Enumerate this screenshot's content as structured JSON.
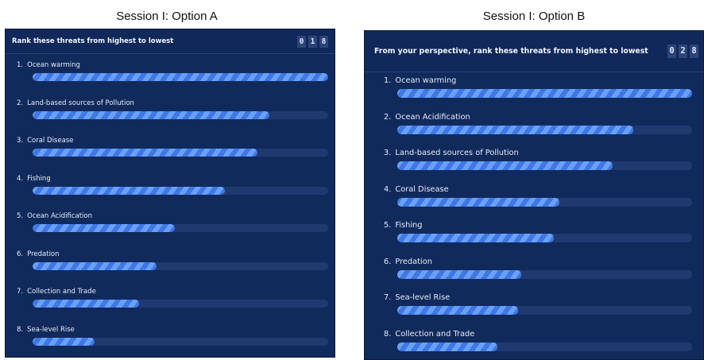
{
  "option_a": {
    "caption": "Session I: Option A",
    "question": "Rank these threats from highest to lowest",
    "counter": [
      "0",
      "1",
      "8"
    ],
    "items": [
      {
        "rank": "1.",
        "label": "Ocean warming",
        "fill": 1.0
      },
      {
        "rank": "2.",
        "label": "Land-based sources of Pollution",
        "fill": 0.8
      },
      {
        "rank": "3.",
        "label": "Coral Disease",
        "fill": 0.76
      },
      {
        "rank": "4.",
        "label": "Fishing",
        "fill": 0.65
      },
      {
        "rank": "5.",
        "label": "Ocean Acidification",
        "fill": 0.48
      },
      {
        "rank": "6.",
        "label": "Predation",
        "fill": 0.42
      },
      {
        "rank": "7.",
        "label": "Collection and Trade",
        "fill": 0.36
      },
      {
        "rank": "8.",
        "label": "Sea-level Rise",
        "fill": 0.21
      }
    ]
  },
  "option_b": {
    "caption": "Session I: Option B",
    "question": "From your perspective, rank these threats from highest to lowest",
    "counter": [
      "0",
      "2",
      "8"
    ],
    "items": [
      {
        "rank": "1.",
        "label": "Ocean warming",
        "fill": 1.0
      },
      {
        "rank": "2.",
        "label": "Ocean Acidification",
        "fill": 0.8
      },
      {
        "rank": "3.",
        "label": "Land-based sources of Pollution",
        "fill": 0.73
      },
      {
        "rank": "4.",
        "label": "Coral Disease",
        "fill": 0.55
      },
      {
        "rank": "5.",
        "label": "Fishing",
        "fill": 0.53
      },
      {
        "rank": "6.",
        "label": "Predation",
        "fill": 0.42
      },
      {
        "rank": "7.",
        "label": "Sea-level Rise",
        "fill": 0.41
      },
      {
        "rank": "8.",
        "label": "Collection and Trade",
        "fill": 0.34
      }
    ]
  },
  "colors": {
    "panel_background": "#112a5c",
    "track": "#1f3a6f",
    "bar_fill": "#4c86ee",
    "bar_stripe": "#6aa0f7"
  }
}
